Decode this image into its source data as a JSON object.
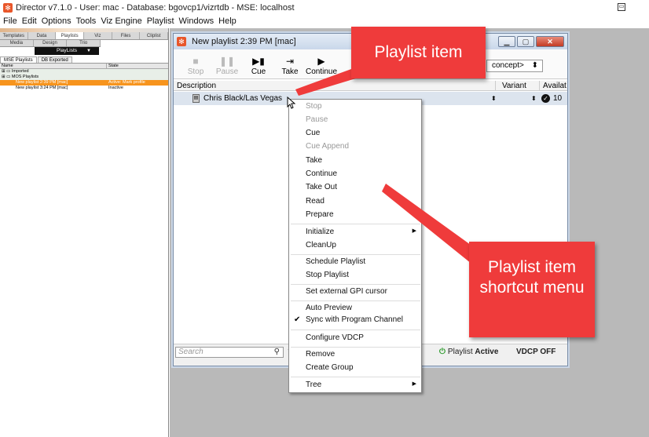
{
  "window": {
    "title": "Director v7.1.0  - User: mac - Database: bgovcp1/vizrtdb - MSE: localhost"
  },
  "menu": [
    "File",
    "Edit",
    "Options",
    "Tools",
    "Viz Engine",
    "Playlist",
    "Windows",
    "Help"
  ],
  "left_panel": {
    "tabs_row1": [
      "Templates",
      "Data",
      "Playlists",
      "Viz",
      "Files",
      "Cliplist"
    ],
    "tabs_row2": [
      "Media",
      "Design",
      "Trio"
    ],
    "playlists_label": "PlayLists",
    "subtabs": [
      "MSE Playlists",
      "DB Exported"
    ],
    "columns": [
      "Name",
      "State"
    ],
    "rows": [
      {
        "name": "Imported",
        "state": ""
      },
      {
        "name": "MOS Playlists",
        "state": ""
      },
      {
        "name": "New playlist 2:39 PM [mac]",
        "state": "Active: Mark profile"
      },
      {
        "name": "New playlist 3:24 PM [mac]",
        "state": "Inactive"
      }
    ]
  },
  "playlist_window": {
    "title": "New playlist 2:39 PM [mac]",
    "toolbar": {
      "stop": "Stop",
      "pause": "Pause",
      "cue": "Cue",
      "take": "Take",
      "continue": "Continue"
    },
    "concept_select": "concept>",
    "columns": {
      "description": "Description",
      "variant": "Variant",
      "available": "Availat"
    },
    "item": {
      "name": "Chris Black/Las Vegas",
      "available": "10"
    },
    "search_placeholder": "Search",
    "status": {
      "playlist": "Playlist",
      "active": "Active",
      "vdcp": "VDCP OFF"
    }
  },
  "context_menu": {
    "items": [
      {
        "label": "Stop",
        "enabled": false
      },
      {
        "label": "Pause",
        "enabled": false
      },
      {
        "label": "Cue",
        "enabled": true
      },
      {
        "label": "Cue Append",
        "enabled": false
      },
      {
        "label": "Take",
        "enabled": true
      },
      {
        "label": "Continue",
        "enabled": true
      },
      {
        "label": "Take Out",
        "enabled": true
      },
      {
        "label": "Read",
        "enabled": true
      },
      {
        "label": "Prepare",
        "enabled": true
      },
      {
        "label": "Initialize",
        "enabled": true,
        "submenu": true
      },
      {
        "label": "CleanUp",
        "enabled": true
      },
      {
        "label": "Schedule Playlist",
        "enabled": true
      },
      {
        "label": "Stop Playlist",
        "enabled": true
      },
      {
        "label": "Set external GPI cursor",
        "enabled": true
      },
      {
        "label": "Auto Preview",
        "enabled": true
      },
      {
        "label": "Sync with Program Channel",
        "enabled": true,
        "checked": true
      },
      {
        "label": "Configure VDCP",
        "enabled": true
      },
      {
        "label": "Remove",
        "enabled": true
      },
      {
        "label": "Create Group",
        "enabled": true
      },
      {
        "label": "Tree",
        "enabled": true,
        "submenu": true
      }
    ]
  },
  "callouts": {
    "playlist_item": "Playlist item",
    "shortcut_menu": "Playlist item shortcut menu"
  },
  "colors": {
    "callout": "#ef3b3b",
    "selected_row": "#f7941d",
    "workspace": "#b9b9b9"
  }
}
